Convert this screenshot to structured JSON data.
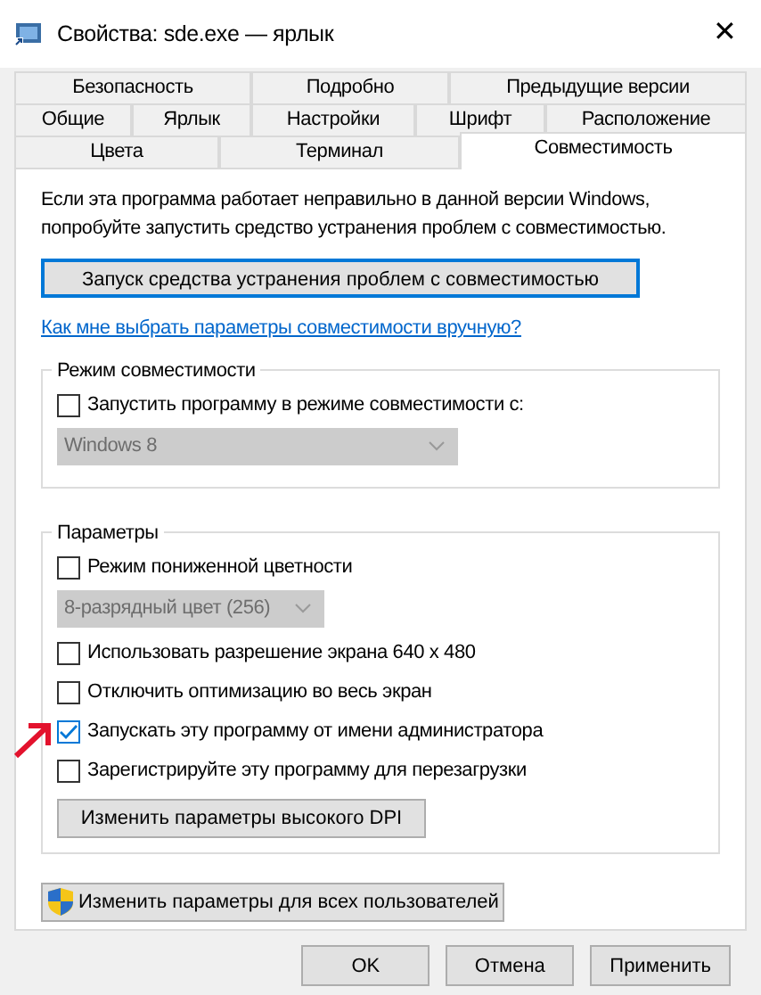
{
  "window": {
    "title": "Свойства: sde.exe — ярлык",
    "close": "✕"
  },
  "tabs": [
    [
      {
        "label": "Безопасность",
        "selected": false
      },
      {
        "label": "Подробно",
        "selected": false
      },
      {
        "label": "Предыдущие версии",
        "selected": false
      }
    ],
    [
      {
        "label": "Общие",
        "selected": false
      },
      {
        "label": "Ярлык",
        "selected": false
      },
      {
        "label": "Настройки",
        "selected": false
      },
      {
        "label": "Шрифт",
        "selected": false
      },
      {
        "label": "Расположение",
        "selected": false
      }
    ],
    [
      {
        "label": "Цвета",
        "selected": false
      },
      {
        "label": "Терминал",
        "selected": false
      },
      {
        "label": "Совместимость",
        "selected": true
      }
    ]
  ],
  "intro": "Если эта программа работает неправильно в данной версии Windows, попробуйте запустить средство устранения проблем с совместимостью.",
  "troubleshoot_button": "Запуск средства устранения проблем с совместимостью",
  "help_link": "Как мне выбрать параметры совместимости вручную?",
  "groups": [
    {
      "title": "Режим совместимости",
      "items": [
        {
          "kind": "checkbox",
          "label": "Запустить программу в режиме совместимости с:",
          "checked": false
        },
        {
          "kind": "dropdown",
          "value": "Windows 8",
          "disabled": true,
          "wide": true
        }
      ]
    },
    {
      "title": "Параметры",
      "items": [
        {
          "kind": "checkbox",
          "label": "Режим пониженной цветности",
          "checked": false
        },
        {
          "kind": "dropdown",
          "value": "8-разрядный цвет (256)",
          "disabled": true,
          "wide": false
        },
        {
          "kind": "checkbox",
          "label": "Использовать разрешение экрана 640 x 480",
          "checked": false
        },
        {
          "kind": "checkbox",
          "label": "Отключить оптимизацию во весь экран",
          "checked": false
        },
        {
          "kind": "checkbox",
          "label": "Запускать эту программу от имени администратора",
          "checked": true
        },
        {
          "kind": "checkbox",
          "label": "Зарегистрируйте эту программу для перезагрузки",
          "checked": false
        },
        {
          "kind": "button",
          "label": "Изменить параметры высокого DPI"
        }
      ]
    }
  ],
  "all_users_button": "Изменить параметры для всех пользователей",
  "buttons": [
    "OK",
    "Отмена",
    "Применить"
  ]
}
